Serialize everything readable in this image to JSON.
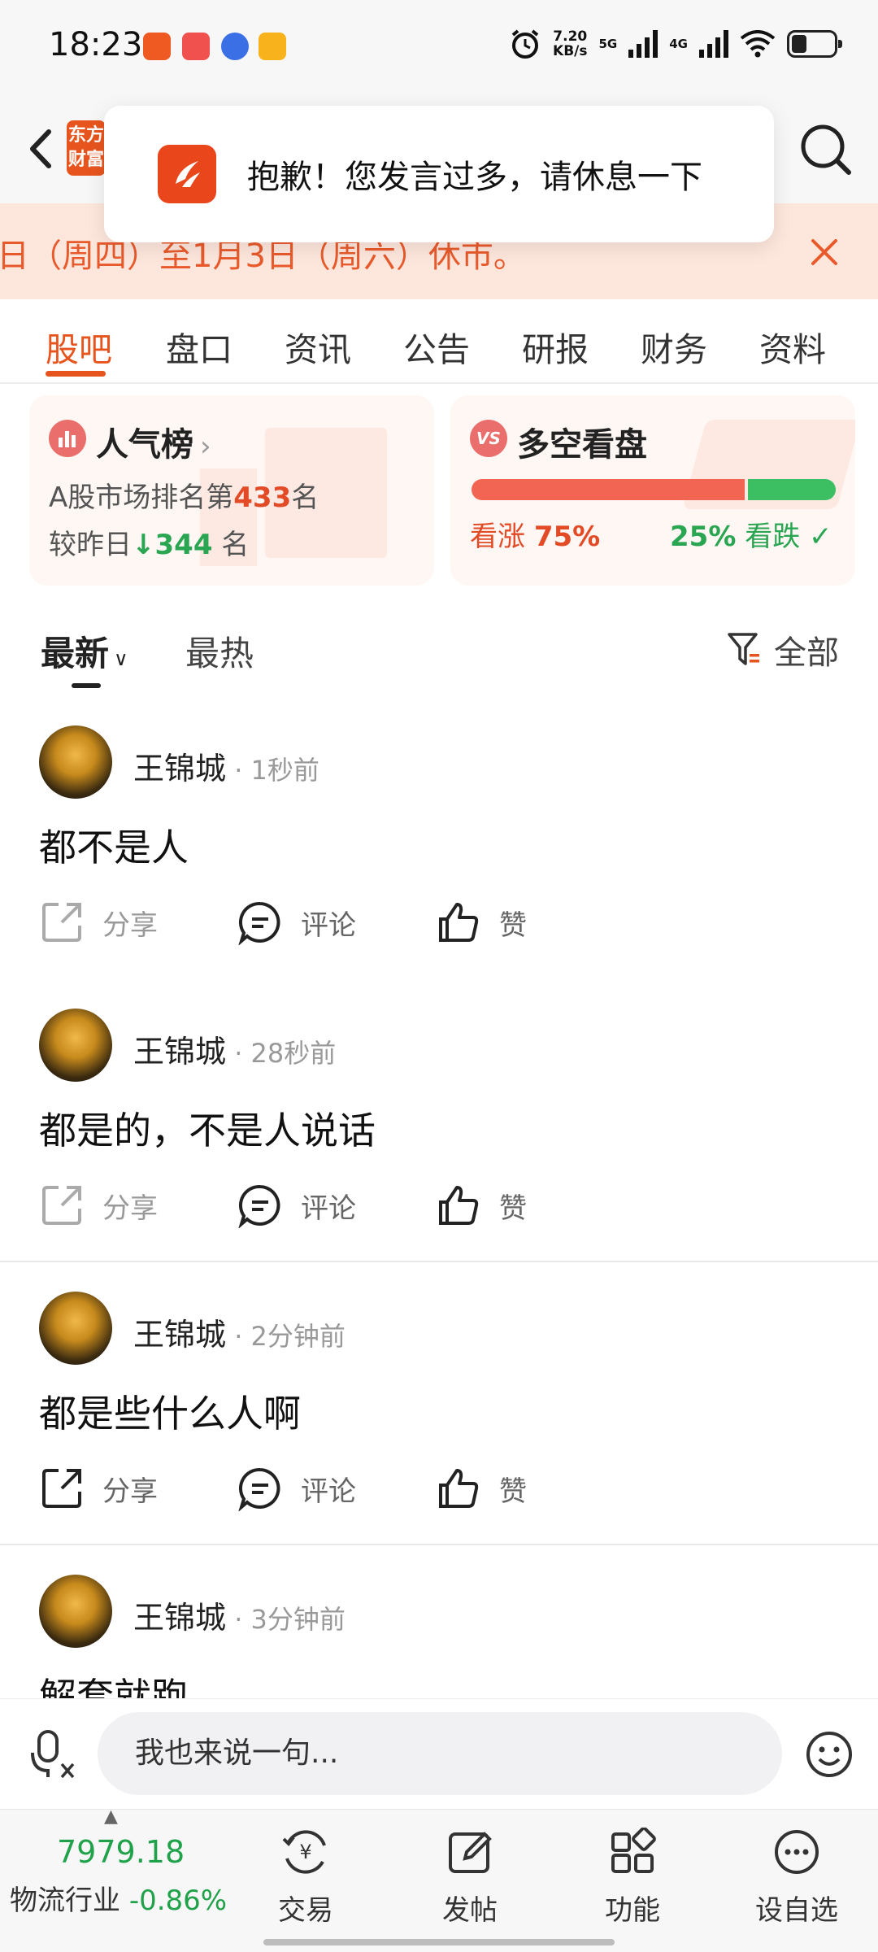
{
  "status_bar": {
    "time": "18:23",
    "speed_value": "7.20",
    "speed_unit": "KB/s",
    "net1": "5G",
    "net2": "4G"
  },
  "toast": {
    "message": "抱歉！您发言过多，请休息一下"
  },
  "header": {
    "logo_line1": "东方",
    "logo_line2": "财富"
  },
  "notice": {
    "text": "日（周四）至1月3日（周六）休市。"
  },
  "tabs": [
    "股吧",
    "盘口",
    "资讯",
    "公告",
    "研报",
    "财务",
    "资料"
  ],
  "popularity": {
    "title": "人气榜",
    "rank_prefix": "A股市场排名第",
    "rank_value": "433",
    "rank_suffix": "名",
    "change_prefix": "较昨日",
    "change_value": "344",
    "change_suffix": " 名"
  },
  "sentiment": {
    "title": "多空看盘",
    "bull_label": "看涨",
    "bull_value": "75%",
    "bear_value": "25%",
    "bear_label": "看跌",
    "bull_fraction": 0.75
  },
  "sort": {
    "newest": "最新",
    "hottest": "最热",
    "filter": "全部"
  },
  "actions": {
    "share": "分享",
    "comment": "评论",
    "like": "赞"
  },
  "posts": [
    {
      "user": "王锦城",
      "time": "1秒前",
      "content": "都不是人"
    },
    {
      "user": "王锦城",
      "time": "28秒前",
      "content": "都是的，不是人说话"
    },
    {
      "user": "王锦城",
      "time": "2分钟前",
      "content": "都是些什么人啊"
    },
    {
      "user": "王锦城",
      "time": "3分钟前",
      "content": "解套就跑"
    }
  ],
  "input": {
    "placeholder": "我也来说一句..."
  },
  "bottom_nav": {
    "price": "7979.18",
    "industry_name": "物流行业",
    "industry_change": "-0.86%",
    "trade": "交易",
    "post": "发帖",
    "function": "功能",
    "watchlist": "设自选"
  },
  "colors": {
    "accent": "#e8541e",
    "up_red": "#e24b26",
    "down_green": "#2aa653"
  }
}
